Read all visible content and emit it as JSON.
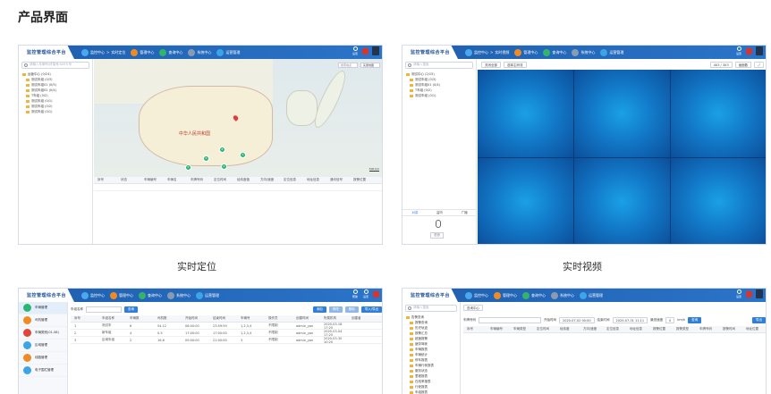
{
  "page_title": "产品界面",
  "platform_title": "监控管理综合平台",
  "nav": {
    "monitor": "监控中心",
    "realtime_location": "实时定位",
    "realtime_video": "实时视频",
    "manage": "管理中心",
    "query": "查询中心",
    "system": "系统中心",
    "ops": "运营管理"
  },
  "top_right": {
    "settings": "设置",
    "help": "帮助"
  },
  "map_panel": {
    "search_placeholder": "请输入车牌号/终端号/SIM卡号",
    "map_label": "中华人民共和国",
    "map_search": "搜索地点",
    "layer_btn": "矢量地图",
    "scale": "500 km",
    "tree": [
      "运营中心 (0/24)",
      "测试车组 (0/3)",
      "测试车组01 (0/5)",
      "测试车组02 (0/4)",
      "T车组 (0/2)",
      "测试车组 (0/1)",
      "测试车组 (0/2)",
      "测试车组 (0/1)"
    ],
    "table_headers": [
      "序号",
      "状态",
      "车辆编号",
      "车辆名",
      "车牌号码",
      "定位时间",
      "经纬度值",
      "方向/速度",
      "定位信息",
      "地址信息",
      "通讯信号",
      "报警位置"
    ],
    "markers": [
      "5",
      "6",
      "8",
      "3",
      "2"
    ]
  },
  "video_panel": {
    "search_placeholder": "请输入搜索",
    "btn_close_all": "关闭全部",
    "btn_stream": "选择主码流",
    "layout": "4X3 / 3X3",
    "view": "画面数",
    "tree": [
      "测试中心 (2/15)",
      "测试车组 (0/3)",
      "测试车组01 (0/4)",
      "T车组 (0/2)",
      "测试车组 (0/1)"
    ],
    "tabs": [
      "对讲",
      "监听",
      "广播"
    ],
    "talk": "语音"
  },
  "captions": {
    "left": "实时定位",
    "right": "实时视频"
  },
  "manage_panel": {
    "menu": [
      "车辆管理",
      "司机管理",
      "车辆类别(01-08)",
      "区域管理",
      "线路管理",
      "电子围栏管理"
    ],
    "search_label": "车组名称",
    "search_btn": "查询",
    "actions": [
      "添加",
      "修改",
      "删除",
      "导入/导出"
    ],
    "headers": [
      "序号",
      "车组名称",
      "车辆数",
      "司机数",
      "开始时间",
      "结束时间",
      "车辆号",
      "操作员",
      "创建时间",
      "所属机构",
      "创建者"
    ],
    "rows": [
      [
        "1",
        "测试车",
        "6",
        "54.12",
        "08:00:00",
        "23:59:59",
        "1,2,3,4",
        "不限制",
        "admin_ypn",
        "2020-03-18 17:25"
      ],
      [
        "2",
        "新车组",
        "4",
        "0.5",
        "17:00:00",
        "17:00:00",
        "1,2,3,4",
        "不限制",
        "admin_ypn",
        "2020-03-04 17:25"
      ],
      [
        "3",
        "区域车组",
        "2",
        "16.6",
        "09:00:00",
        "21:00:00",
        "3",
        "不限制",
        "admin_ypn",
        "2020-03-30 10:20"
      ]
    ]
  },
  "query_panel": {
    "search_placeholder": "请输入搜索",
    "tree": [
      "告警查询",
      "报警查询",
      "历史轨迹",
      "报警汇总",
      "超速报警",
      "疲劳驾驶",
      "车辆报表",
      "车辆统计",
      "停车报表",
      "车辆行驶报表",
      "服务状态",
      "里程报表",
      "在线率报表",
      "行驶报表",
      "车组报表",
      "日报表查询"
    ],
    "btn_export_top": "查询中心",
    "label_plate": "车牌号码",
    "label_start": "开始时间",
    "start": "2020-07-02 00:00",
    "label_end": "结束时间",
    "end": "2020-07-31 11:11",
    "label_speed": "最低速度",
    "speed": "0",
    "unit": "km/h",
    "btn_search": "查询",
    "btn_export": "导出",
    "headers": [
      "序号",
      "车辆编号",
      "车辆类型",
      "定位时间",
      "经纬度",
      "方向/速度",
      "定位信息",
      "地址信息",
      "报警位置",
      "报警类型",
      "车牌号码",
      "报警时间",
      "地址位置"
    ]
  },
  "colors": {
    "topbar": "#2467bb",
    "accent": "#2f7fd8",
    "video": "#1279c8",
    "marker": "#2bb673"
  }
}
